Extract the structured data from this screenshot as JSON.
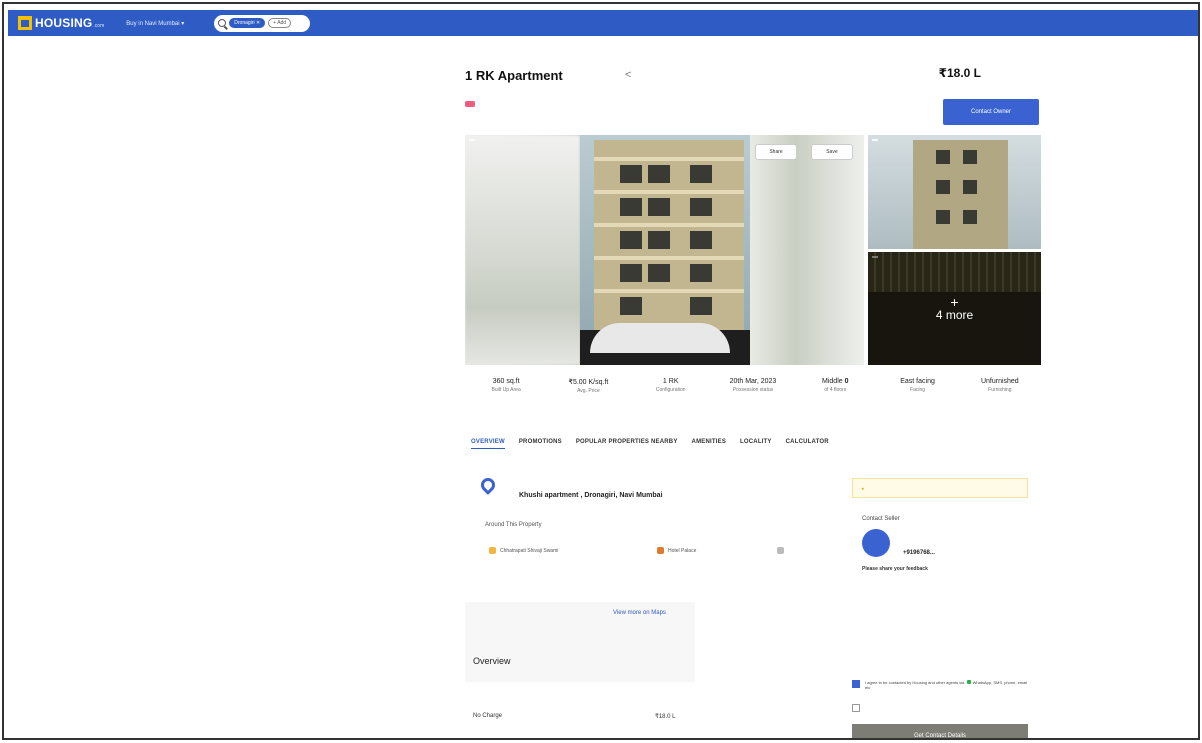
{
  "topbar": {
    "logo_text": "HOUSING",
    "logo_sub": ".com",
    "city_dropdown": "Buy in Navi Mumbai ▾",
    "search_chip": "Dronagiri ✕",
    "search_add": "+ Add"
  },
  "header": {
    "breadcrumb": "",
    "posted": "",
    "title": "1 RK Apartment",
    "subtitle": "",
    "price": "₹18.0 L",
    "emi": "",
    "price_per_sqft": "",
    "rera_badge": "",
    "rera_text": "",
    "rera_link": "",
    "contact_button": "Contact Owner"
  },
  "gallery": {
    "main_tag": "",
    "share_button": "Share",
    "save_button": "Save",
    "side1_tag": "",
    "side2_tag": "",
    "more_label": "4 more"
  },
  "stats": [
    {
      "value": "360 sq.ft",
      "label": "Built Up Area"
    },
    {
      "value": "₹5.00 K/sq.ft",
      "label": "Avg. Price"
    },
    {
      "value": "1 RK",
      "label": "Configuration"
    },
    {
      "value": "20th Mar, 2023",
      "label": "Possession status"
    },
    {
      "value": "Middle",
      "extra": "0",
      "label": "of 4 floors"
    },
    {
      "value": "East facing",
      "label": "Facing"
    },
    {
      "value": "Unfurnished",
      "label": "Furnishing"
    }
  ],
  "tabs": [
    "OVERVIEW",
    "PROMOTIONS",
    "POPULAR PROPERTIES NEARBY",
    "AMENITIES",
    "LOCALITY",
    "CALCULATOR"
  ],
  "location": {
    "label": "",
    "name": "Khushi apartment , Dronagiri, Navi Mumbai",
    "around_title": "Around This Property",
    "around": [
      {
        "name": "Chhatrapati Shivaji Swami",
        "link": ""
      },
      {
        "name": "Hotel Palace",
        "link": ""
      },
      {
        "name": ""
      }
    ],
    "map_link": "View more on Maps"
  },
  "overview": {
    "title": "Overview",
    "left_label": "",
    "left_value": "No Charge",
    "right_label": "",
    "right_value": "₹18.0 L",
    "right_link": ""
  },
  "seller": {
    "promo": "",
    "contact_title": "Contact Seller",
    "avatar": "",
    "name": "",
    "role": "",
    "phone": "+9196768...",
    "share_note": "Please share your feedback",
    "tiny_glyph": "",
    "consent_1a": "I agree to be contacted by Housing and other agents via",
    "consent_1b": "WhatsApp, SMS, phone, email etc",
    "consent_2": "",
    "get_contact": "Get Contact Details"
  }
}
